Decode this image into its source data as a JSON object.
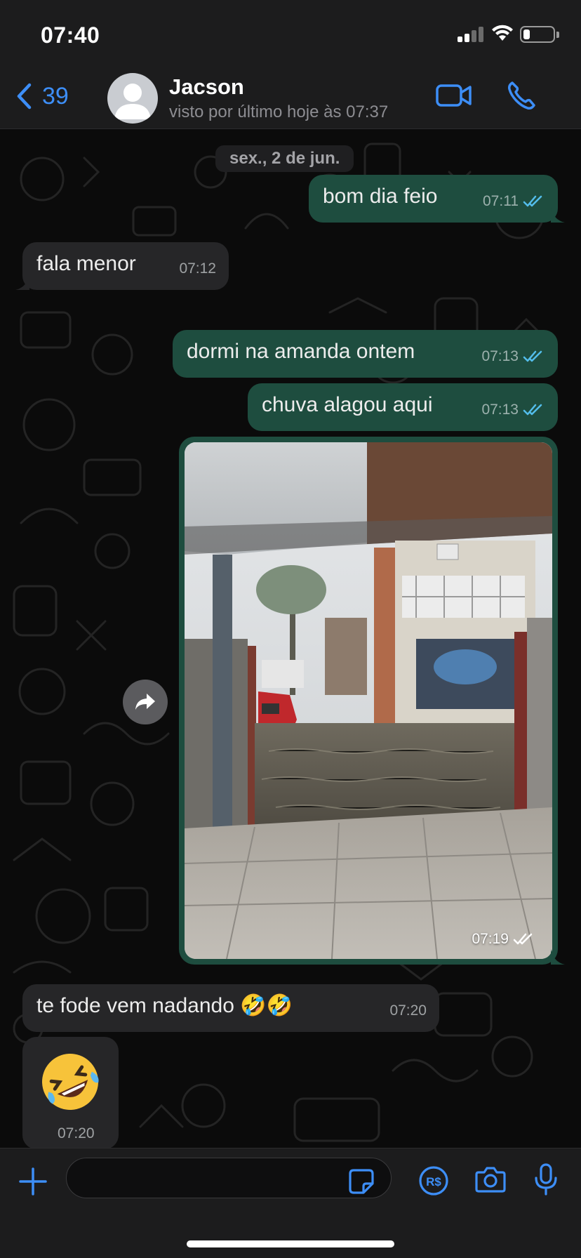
{
  "status_bar": {
    "time": "07:40",
    "battery_level": 0.22
  },
  "header": {
    "back_count": "39",
    "contact_name": "Jacson",
    "last_seen": "visto por último hoje às 07:37"
  },
  "chat": {
    "date_chip": "sex., 2 de jun.",
    "messages": [
      {
        "direction": "out",
        "text": "bom dia feio",
        "time": "07:11",
        "status": "read"
      },
      {
        "direction": "in",
        "text": "fala menor",
        "time": "07:12"
      },
      {
        "direction": "out",
        "text": "dormi na amanda ontem",
        "time": "07:13",
        "status": "read"
      },
      {
        "direction": "out",
        "text": "chuva alagou aqui",
        "time": "07:13",
        "status": "read"
      },
      {
        "direction": "out",
        "type": "photo",
        "time": "07:19",
        "status": "read"
      },
      {
        "direction": "in",
        "text": "te fode vem nadando 🤣🤣",
        "time": "07:20"
      },
      {
        "direction": "in",
        "type": "sticker",
        "emoji": "🤣",
        "time": "07:20"
      }
    ]
  },
  "input_bar": {
    "placeholder": "",
    "value": ""
  },
  "colors": {
    "accent": "#3d8ef7",
    "out_bubble": "#1e4d3f",
    "in_bubble": "#262628",
    "read_ticks": "#53bdeb"
  }
}
